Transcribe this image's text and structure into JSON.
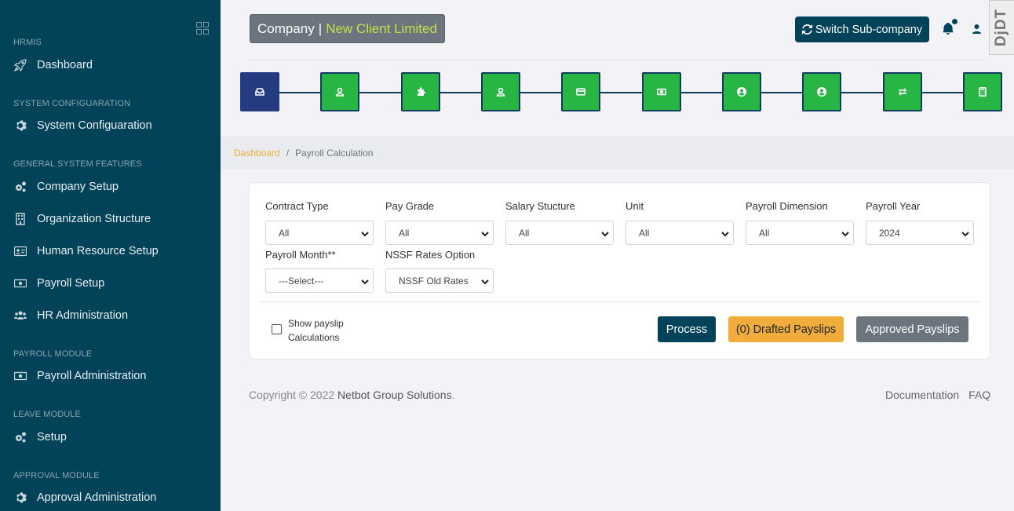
{
  "sidebar": {
    "sections": {
      "hrmis": "HRMIS",
      "system_config": "SYSTEM CONFIGUARATION",
      "general": "GENERAL SYSTEM FEATURES",
      "payroll": "PAYROLL MODULE",
      "leave": "LEAVE MODULE",
      "approval": "APPROVAL MODULE"
    },
    "items": {
      "dashboard": "Dashboard",
      "system_configuaration": "System Configuaration",
      "company_setup": "Company Setup",
      "organization_structure": "Organization Structure",
      "human_resource_setup": "Human Resource Setup",
      "payroll_setup": "Payroll Setup",
      "hr_administration": "HR Administration",
      "payroll_administration": "Payroll Administration",
      "leave_setup": "Setup",
      "approval_administration": "Approval Administration"
    }
  },
  "header": {
    "company_label": "Company",
    "separator": "|",
    "client_name": "New Client Limited",
    "switch_label": "Switch Sub-company",
    "debug_toolbar": "DjDT"
  },
  "steps": [
    {
      "icon": "inbox-icon",
      "state": "active"
    },
    {
      "icon": "user-icon",
      "state": "done"
    },
    {
      "icon": "puzzle-icon",
      "state": "done"
    },
    {
      "icon": "user-icon",
      "state": "done"
    },
    {
      "icon": "credit-card-icon",
      "state": "done"
    },
    {
      "icon": "money-bill-icon",
      "state": "done"
    },
    {
      "icon": "user-circle-icon",
      "state": "done"
    },
    {
      "icon": "user-circle-icon",
      "state": "done"
    },
    {
      "icon": "exchange-icon",
      "state": "done"
    },
    {
      "icon": "calculator-icon",
      "state": "done"
    }
  ],
  "breadcrumb": {
    "home": "Dashboard",
    "separator": "/",
    "current": "Payroll Calculation"
  },
  "form": {
    "contract_type": {
      "label": "Contract Type",
      "value": "All"
    },
    "pay_grade": {
      "label": "Pay Grade",
      "value": "All"
    },
    "salary_structure": {
      "label": "Salary Stucture",
      "value": "All"
    },
    "unit": {
      "label": "Unit",
      "value": "All"
    },
    "payroll_dimension": {
      "label": "Payroll Dimension",
      "value": "All"
    },
    "payroll_year": {
      "label": "Payroll Year",
      "value": "2024"
    },
    "payroll_month": {
      "label": "Payroll Month**",
      "value": "---Select---"
    },
    "nssf_rates": {
      "label": "NSSF Rates Option",
      "value": "NSSF Old Rates"
    },
    "show_payslip": {
      "label": "Show payslip Calculations",
      "checked": false
    }
  },
  "actions": {
    "process": "Process",
    "drafted": "(0) Drafted Payslips",
    "approved": "Approved Payslips"
  },
  "footer": {
    "copyright": "Copyright © 2022",
    "brand": "Netbot Group Solutions",
    "period": ".",
    "documentation": "Documentation",
    "faq": "FAQ"
  },
  "colors": {
    "sidebar_bg": "#024359",
    "step_done": "#27b644",
    "step_active": "#243b82",
    "drafted_button": "#f0ad3c",
    "client_name": "#c5e24a"
  }
}
